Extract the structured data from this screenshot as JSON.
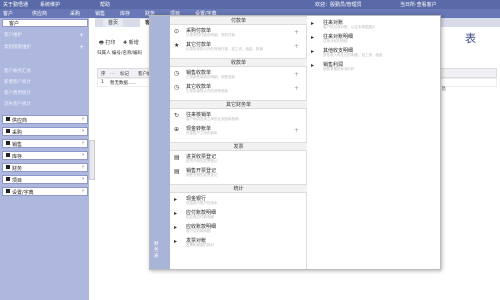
{
  "topbar": {
    "left_items": [
      "关于勤悟通",
      "系统维护",
      "帮助"
    ],
    "user": "欢迎：殷勤员/管理员",
    "right": "当日所·查看客户"
  },
  "toolbar": {
    "items": [
      "客户",
      "供应商",
      "采购",
      "销售",
      "库存",
      "财务",
      "项目",
      "设置/字典"
    ]
  },
  "sidebar": {
    "header": "客户",
    "subitems": [
      "客户维护",
      "类别限额维护"
    ],
    "reports": [
      "客户帐务汇总",
      "新增客户统计",
      "客户费用统计",
      "流失客户统计"
    ],
    "modules": [
      "供应商",
      "采购",
      "销售",
      "库存",
      "财务",
      "项目",
      "设置/字典"
    ]
  },
  "main": {
    "tabs": [
      "首页",
      "客户"
    ],
    "title": "表",
    "tools": [
      "打印",
      "新增"
    ],
    "filter": "归属人  编号/名称/编码",
    "grid_headers": [
      "序",
      "...",
      "标记",
      "客户编码"
    ],
    "grid_row": [
      "1",
      "暂无数据......"
    ],
    "right_col": "信息"
  },
  "flyout": {
    "strip_label": "财务表",
    "sections": [
      {
        "title": "付款单",
        "items": [
          {
            "label": "采购付款单",
            "desc": "记录采购付款的明细，采购付款",
            "plus": true
          },
          {
            "label": "其它付款单",
            "desc": "记录除采购以外的其他付款，如工资、租金、报销",
            "plus": true
          }
        ]
      },
      {
        "title": "收款单",
        "items": [
          {
            "label": "销售收款单",
            "desc": "记录销售收款的明细，销售收款",
            "plus": true
          },
          {
            "label": "其它收款单",
            "desc": "记录除销售以外的其他收款",
            "plus": true
          }
        ]
      },
      {
        "title": "其它财务单",
        "items": [
          {
            "label": "往来核销单",
            "desc": "客户和供应商之间的往来账款核销",
            "plus": false
          },
          {
            "label": "现金转帐单",
            "desc": "资金账户之间的转帐",
            "plus": true
          }
        ]
      },
      {
        "title": "发票",
        "items": [
          {
            "label": "进货收票登记",
            "desc": "进货开具的发票登记",
            "plus": false
          },
          {
            "label": "销售开票登记",
            "desc": "销售开具的发票登记",
            "plus": false
          }
        ]
      },
      {
        "title": "统计",
        "items": [
          {
            "label": "现金银行",
            "desc": "现金银行账户的流水",
            "plus": false
          },
          {
            "label": "应付账款明细",
            "desc": "供应商应付款明细",
            "plus": false
          },
          {
            "label": "应收账款明细",
            "desc": "客户应收款明细",
            "plus": false
          },
          {
            "label": "发票对帐",
            "desc": "发票和单据的核对",
            "plus": false
          }
        ]
      }
    ],
    "col2": [
      {
        "label": "往来对账",
        "desc": "客户供应商对账，以往来单据展示"
      },
      {
        "label": "往来对账明细",
        "desc": "往来对帐的明细"
      },
      {
        "label": "其他收支明细",
        "desc": "其他收入和支出的明细，如工资、租金"
      },
      {
        "label": "销售利润",
        "desc": "销售单据的利润分析"
      }
    ]
  }
}
